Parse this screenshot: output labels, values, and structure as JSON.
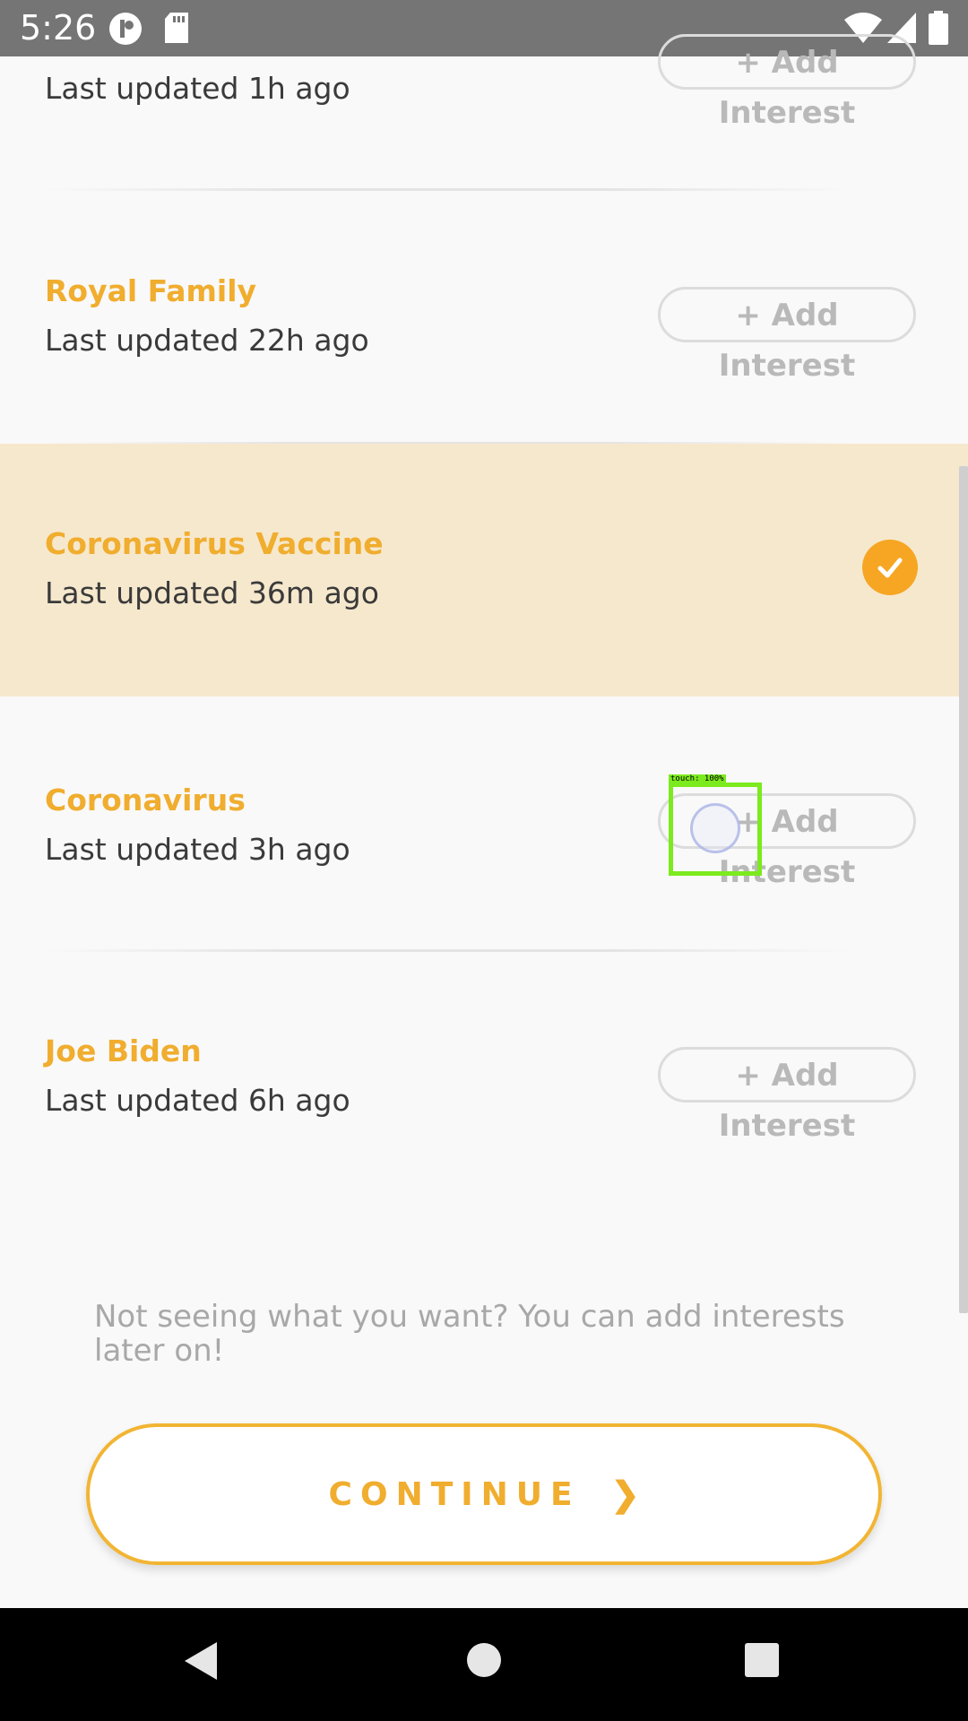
{
  "status_bar": {
    "time": "5:26"
  },
  "items": [
    {
      "title": "",
      "subtitle": "Last updated 1h ago",
      "button": "+ Add Interest",
      "selected": false
    },
    {
      "title": "Royal Family",
      "subtitle": "Last updated 22h ago",
      "button": "+ Add Interest",
      "selected": false
    },
    {
      "title": "Coronavirus Vaccine",
      "subtitle": "Last updated 36m ago",
      "button": "",
      "selected": true
    },
    {
      "title": "Coronavirus",
      "subtitle": "Last updated 3h ago",
      "button": "+ Add Interest",
      "selected": false
    },
    {
      "title": "Joe Biden",
      "subtitle": "Last updated 6h ago",
      "button": "+ Add Interest",
      "selected": false
    }
  ],
  "hint": "Not seeing what you want? You can add interests later on!",
  "continue": {
    "label": "CONTINUE",
    "chevron": "❯"
  },
  "touch_overlay": {
    "label": "touch: 100%"
  },
  "colors": {
    "accent": "#f0ad2e",
    "selected_bg": "#f6e8cd",
    "check": "#f6a623",
    "status_bar": "#757575"
  }
}
